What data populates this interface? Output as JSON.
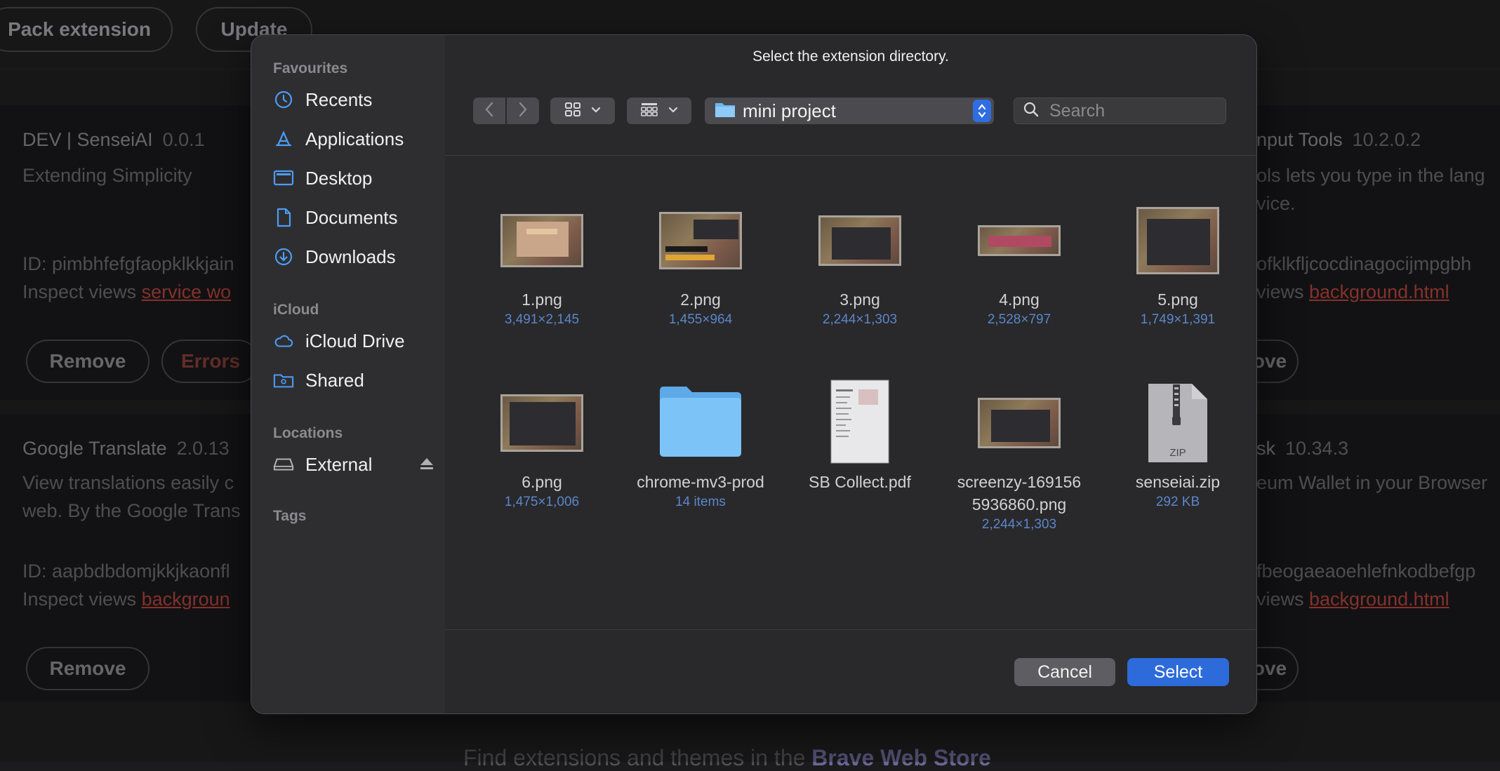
{
  "background": {
    "top_buttons": [
      "Pack extension",
      "Update"
    ],
    "extensions": [
      {
        "name": "DEV | SenseiAI",
        "version": "0.0.1",
        "desc": "Extending Simplicity",
        "id_line": "ID: pimbhfefgfaopklkkjain",
        "inspect_prefix": "Inspect views ",
        "inspect_link": "service wo",
        "buttons": [
          "Remove",
          "Errors"
        ]
      },
      {
        "name": "nput Tools",
        "version": "10.2.0.2",
        "desc": "ols lets you type in the lang\nvice.",
        "id_line": "ofklkfljcocdinagocijmpgbh",
        "inspect_prefix": "views ",
        "inspect_link": "background.html",
        "buttons": [
          "ove"
        ]
      },
      {
        "name": "Google Translate",
        "version": "2.0.13",
        "desc": "View translations easily c\nweb. By the Google Trans",
        "id_line": "ID: aapbdbdomjkkjkaonfl",
        "inspect_prefix": "Inspect views ",
        "inspect_link": "backgroun",
        "buttons": [
          "Remove"
        ]
      },
      {
        "name": "sk",
        "version": "10.34.3",
        "desc": "eum Wallet in your Browser",
        "id_line": "fbeogaeaoehlefnkodbefgp",
        "inspect_prefix": "views ",
        "inspect_link": "background.html",
        "buttons": [
          "ove"
        ]
      }
    ],
    "footer_prefix": "Find extensions and themes in the ",
    "footer_link": "Brave Web Store"
  },
  "dialog": {
    "title": "Select the extension directory.",
    "sidebar": {
      "sections": [
        {
          "heading": "Favourites",
          "items": [
            {
              "label": "Recents",
              "icon": "clock-icon"
            },
            {
              "label": "Applications",
              "icon": "applications-icon"
            },
            {
              "label": "Desktop",
              "icon": "desktop-icon"
            },
            {
              "label": "Documents",
              "icon": "document-icon"
            },
            {
              "label": "Downloads",
              "icon": "download-icon"
            }
          ]
        },
        {
          "heading": "iCloud",
          "items": [
            {
              "label": "iCloud Drive",
              "icon": "cloud-icon"
            },
            {
              "label": "Shared",
              "icon": "shared-folder-icon"
            }
          ]
        },
        {
          "heading": "Locations",
          "items": [
            {
              "label": "External",
              "icon": "drive-icon"
            }
          ]
        },
        {
          "heading": "Tags",
          "items": []
        }
      ]
    },
    "path": "mini project",
    "search_placeholder": "Search",
    "files": [
      {
        "name": "1.png",
        "meta": "3,491×2,145",
        "kind": "image"
      },
      {
        "name": "2.png",
        "meta": "1,455×964",
        "kind": "image"
      },
      {
        "name": "3.png",
        "meta": "2,244×1,303",
        "kind": "image"
      },
      {
        "name": "4.png",
        "meta": "2,528×797",
        "kind": "image"
      },
      {
        "name": "5.png",
        "meta": "1,749×1,391",
        "kind": "image"
      },
      {
        "name": "6.png",
        "meta": "1,475×1,006",
        "kind": "image"
      },
      {
        "name": "chrome-mv3-prod",
        "meta": "14 items",
        "kind": "folder"
      },
      {
        "name": "SB Collect.pdf",
        "meta": "",
        "kind": "pdf"
      },
      {
        "name": "screenzy-1691565936860.png",
        "name_line1": "screenzy-169156",
        "name_line2": "5936860.png",
        "meta": "2,244×1,303",
        "kind": "image"
      },
      {
        "name": "senseiai.zip",
        "meta": "292 KB",
        "kind": "zip",
        "zip_label": "ZIP"
      }
    ],
    "buttons": {
      "cancel": "Cancel",
      "select": "Select"
    },
    "colors": {
      "accent": "#2d6bdb",
      "folder": "#6ab7f5",
      "sidebar_icon": "#4d9cf5",
      "meta_text": "#5b86c9"
    }
  }
}
